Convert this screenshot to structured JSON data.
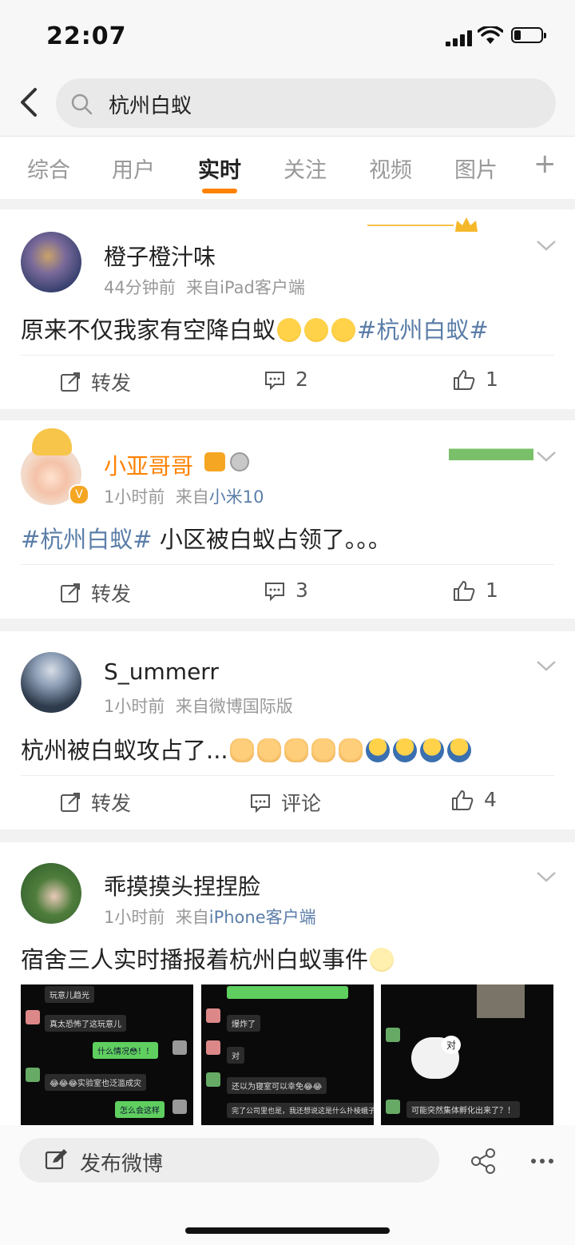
{
  "status": {
    "time": "22:07"
  },
  "search": {
    "query": "杭州白蚁"
  },
  "tabs": [
    {
      "label": "综合"
    },
    {
      "label": "用户"
    },
    {
      "label": "实时"
    },
    {
      "label": "关注"
    },
    {
      "label": "视频"
    },
    {
      "label": "图片"
    }
  ],
  "tabs_plus": "+",
  "accent_color": "#ff8200",
  "link_color": "#5b7ea8",
  "posts": [
    {
      "username": "橙子橙汁味",
      "time": "44分钟前",
      "from_prefix": "来自",
      "source": "iPad客户端",
      "text": "原来不仅我家有空降白蚁",
      "topic": "#杭州白蚁#",
      "repost_label": "转发",
      "comment_count": "2",
      "like_count": "1"
    },
    {
      "username": "小亚哥哥",
      "time": "1小时前",
      "from_prefix": "来自",
      "source": "小米10",
      "topic": "#杭州白蚁#",
      "text": " 小区被白蚁占领了。。。",
      "repost_label": "转发",
      "comment_count": "3",
      "like_count": "1"
    },
    {
      "username": "S_ummerr",
      "time": "1小时前",
      "from_prefix": "来自",
      "source": "微博国际版",
      "text": "杭州被白蚁攻占了...",
      "repost_label": "转发",
      "comment_label": "评论",
      "like_count": "4"
    },
    {
      "username": "乖摸摸头捏捏脸",
      "time": "1小时前",
      "from_prefix": "来自",
      "source": "iPhone客户端",
      "text": "宿舍三人实时播报着杭州白蚁事件",
      "images": [
        {
          "lines": [
            "玩意儿趋光",
            "真太恐怖了这玩意儿",
            "什么情况😳！！",
            "😂😂😂实验室也泛滥成灾",
            "怎么会这样"
          ]
        },
        {
          "lines": [
            "爆炸了",
            "对",
            "还以为寝室可以幸免😂😂",
            "完了公司里也是，我还想说这是什么扑棱蛾子"
          ]
        },
        {
          "lines": [
            "对",
            "可能突然集体孵化出来了？！"
          ]
        }
      ]
    }
  ],
  "bottom": {
    "compose_label": "发布微博"
  }
}
